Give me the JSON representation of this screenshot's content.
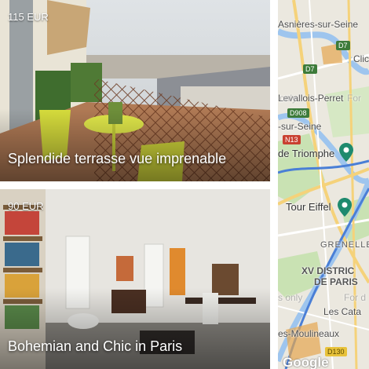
{
  "listings": [
    {
      "price": "115 EUR",
      "title": "Splendide terrasse vue imprenable"
    },
    {
      "price": "90 EUR",
      "title": "Bohemian and Chic in Paris"
    }
  ],
  "map": {
    "labels": {
      "asnieres": "Asnières-sur-Seine",
      "clichy": "Clic",
      "levallois": "Levallois-Perret",
      "sur_seine": "-sur-Seine",
      "triomphe": "de Triomphe",
      "tour_eiffel": "Tour Eiffel",
      "grenelle": "GRENELLE",
      "xv_district": "XV DISTRIC",
      "de_paris": "DE PARIS",
      "les_cata": "Les Cata",
      "moulineaux": "es-Moulineaux",
      "only_1": "only",
      "for_1": "For",
      "only_2": "s only",
      "for_2": "For d"
    },
    "shields": {
      "d7_top": "D7",
      "d7_mid": "D7",
      "d908": "D908",
      "n13": "N13",
      "d130": "D130"
    },
    "attribution": "Google"
  }
}
